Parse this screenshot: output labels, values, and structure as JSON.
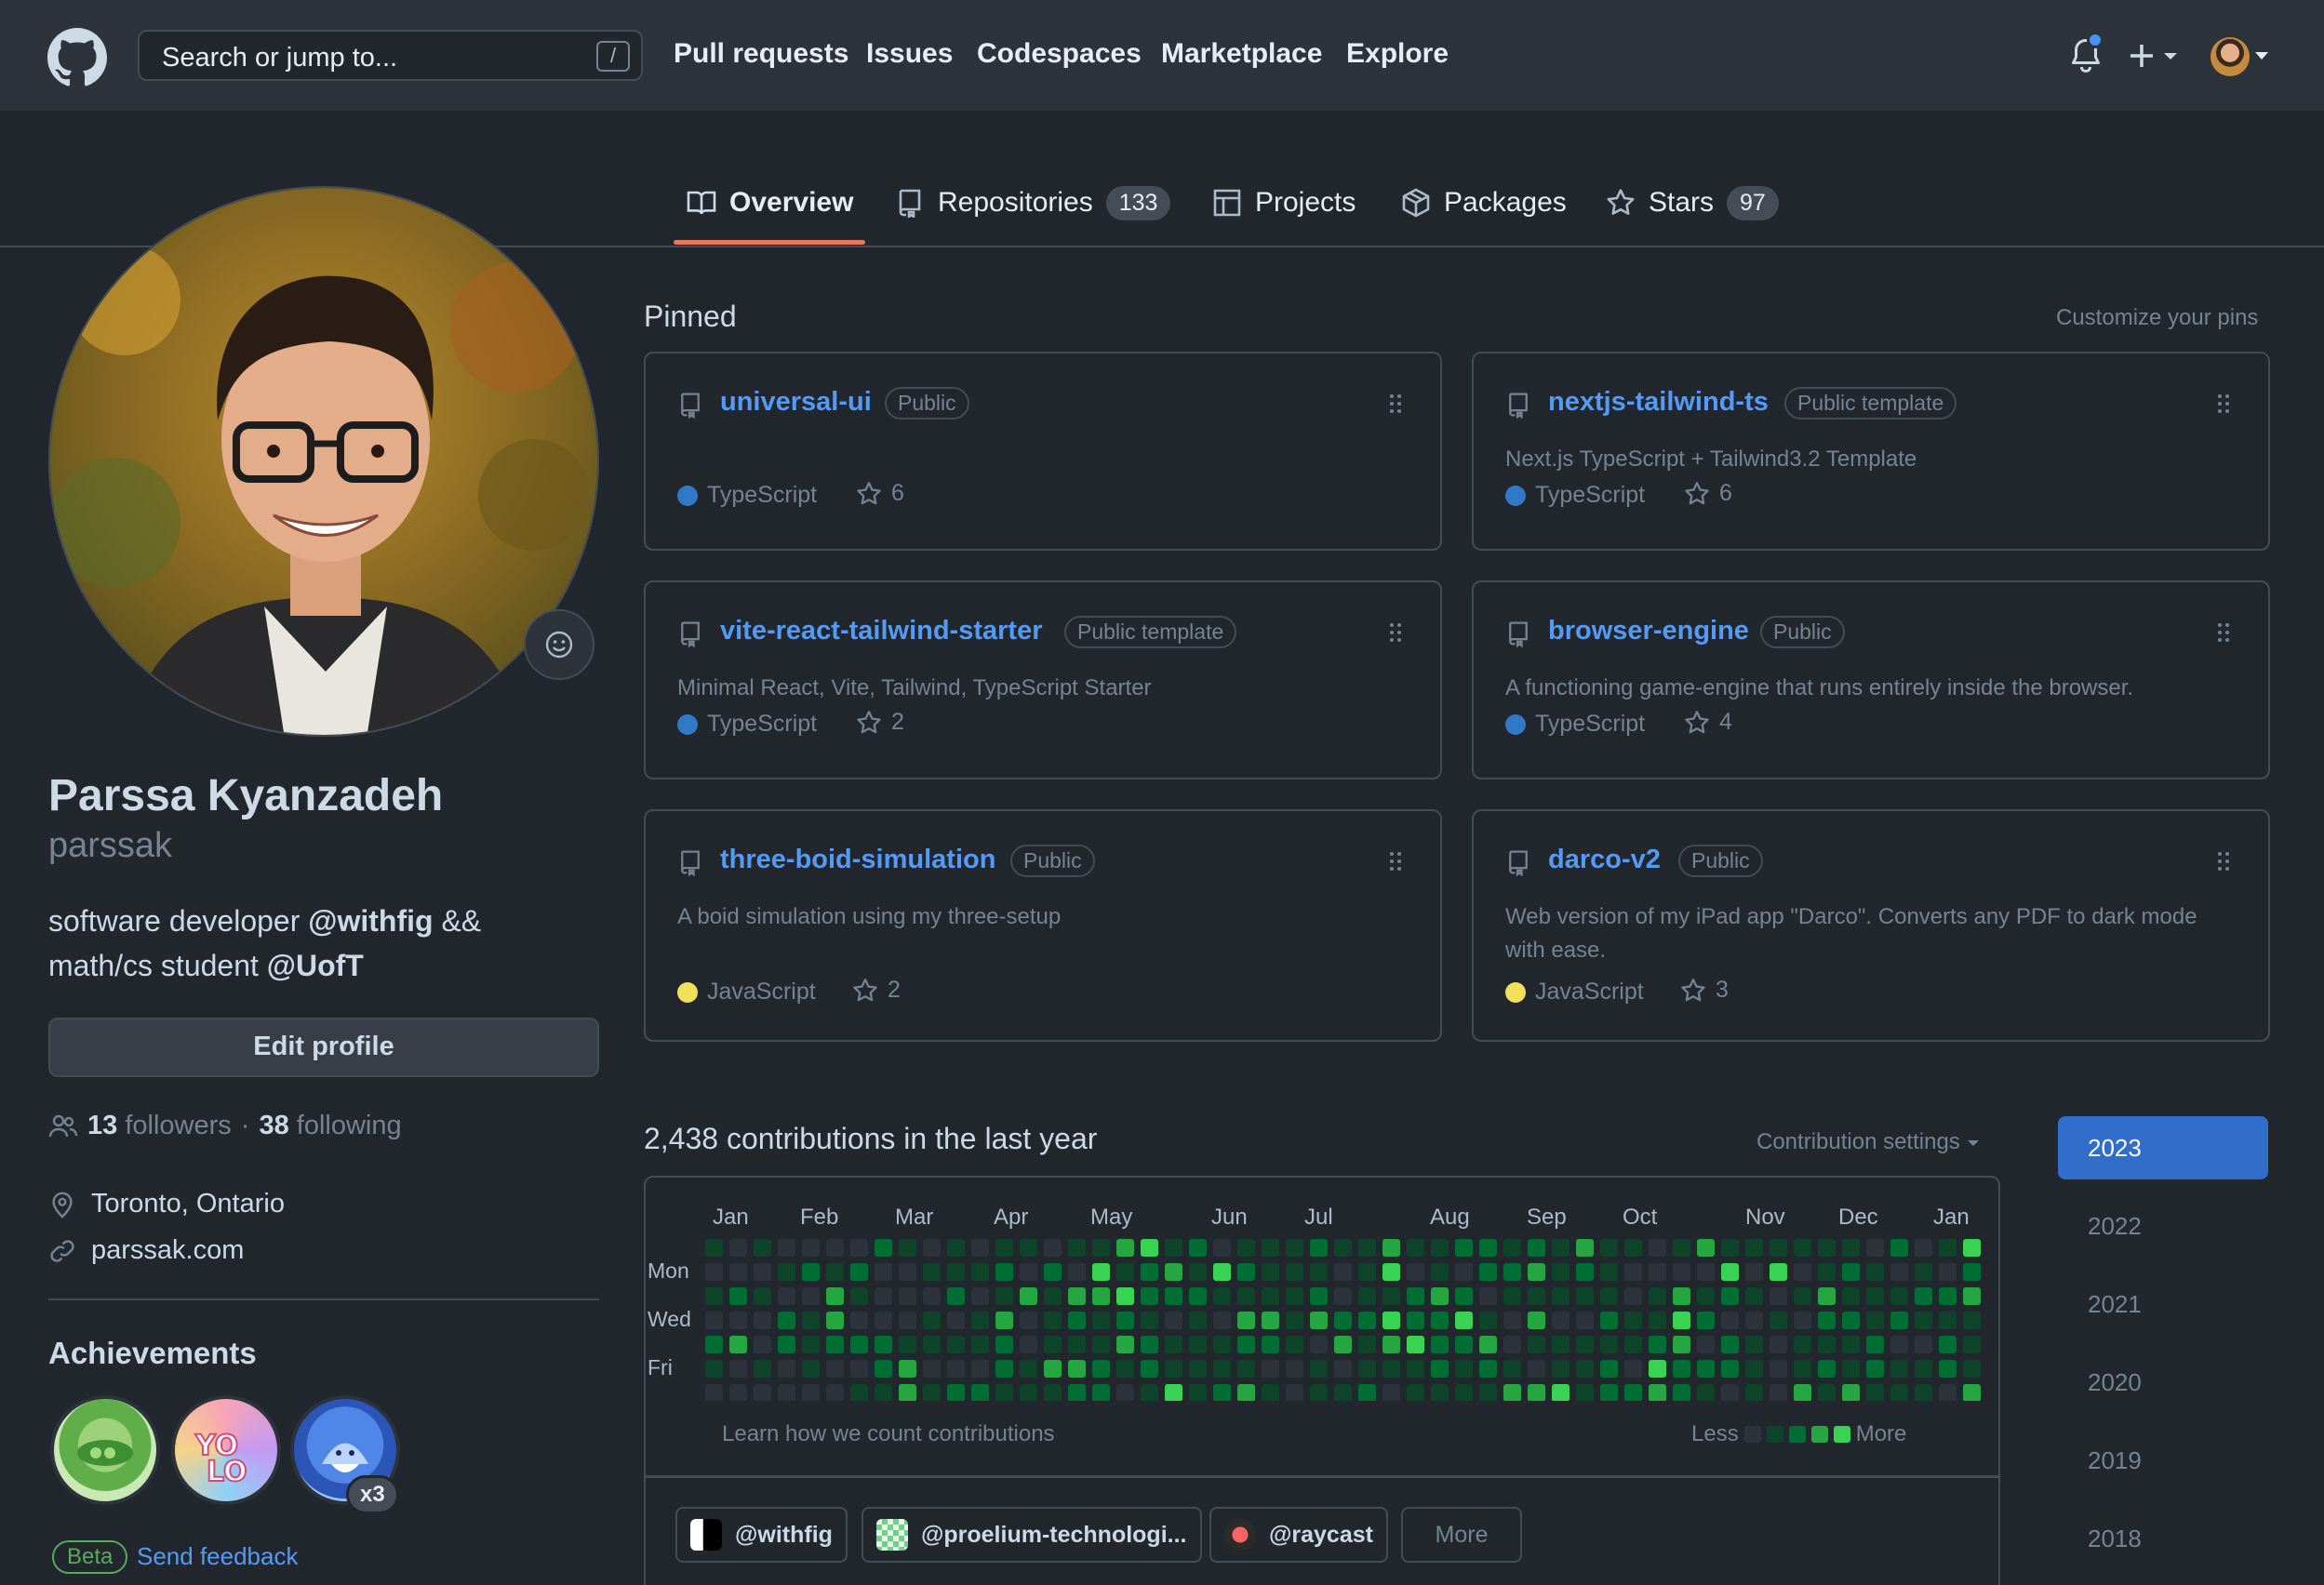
{
  "header": {
    "search_placeholder": "Search or jump to...",
    "search_shortcut": "/",
    "nav": [
      "Pull requests",
      "Issues",
      "Codespaces",
      "Marketplace",
      "Explore"
    ],
    "notification_dot_color": "#4493f8"
  },
  "tabs": [
    {
      "label": "Overview",
      "icon": "book-icon",
      "count": null,
      "active": true
    },
    {
      "label": "Repositories",
      "icon": "repo-icon",
      "count": "133"
    },
    {
      "label": "Projects",
      "icon": "table-icon",
      "count": null
    },
    {
      "label": "Packages",
      "icon": "package-icon",
      "count": null
    },
    {
      "label": "Stars",
      "icon": "star-icon",
      "count": "97"
    }
  ],
  "profile": {
    "name": "Parssa Kyanzadeh",
    "login": "parssak",
    "bio_line1_prefix": "software developer ",
    "bio_line1_org": "@withfig",
    "bio_line1_suffix": " &&",
    "bio_line2_prefix": "math/cs student ",
    "bio_line2_org": "@UofT",
    "edit_button": "Edit profile",
    "followers_count": "13",
    "followers_label": "followers",
    "separator": "·",
    "following_count": "38",
    "following_label": "following",
    "location": "Toronto, Ontario",
    "website": "parssak.com"
  },
  "achievements": {
    "title": "Achievements",
    "badges": [
      "peas-badge",
      "yolo-badge",
      "shark-badge"
    ],
    "shark_multiplier": "x3",
    "beta_label": "Beta",
    "feedback_label": "Send feedback"
  },
  "pinned": {
    "title": "Pinned",
    "customize": "Customize your pins",
    "repos": [
      {
        "name": "universal-ui",
        "visibility": "Public",
        "description": "",
        "language": "TypeScript",
        "lang_color": "#3178c6",
        "stars": "6"
      },
      {
        "name": "nextjs-tailwind-ts",
        "visibility": "Public template",
        "description": "Next.js TypeScript + Tailwind3.2 Template",
        "language": "TypeScript",
        "lang_color": "#3178c6",
        "stars": "6"
      },
      {
        "name": "vite-react-tailwind-starter",
        "visibility": "Public template",
        "description": "Minimal React, Vite, Tailwind, TypeScript Starter",
        "language": "TypeScript",
        "lang_color": "#3178c6",
        "stars": "2"
      },
      {
        "name": "browser-engine",
        "visibility": "Public",
        "description": "A functioning game-engine that runs entirely inside the browser.",
        "language": "TypeScript",
        "lang_color": "#3178c6",
        "stars": "4"
      },
      {
        "name": "three-boid-simulation",
        "visibility": "Public",
        "description": "A boid simulation using my three-setup",
        "language": "JavaScript",
        "lang_color": "#f1e05a",
        "stars": "2"
      },
      {
        "name": "darco-v2",
        "visibility": "Public",
        "description": "Web version of my iPad app \"Darco\". Converts any PDF to dark mode with ease.",
        "language": "JavaScript",
        "lang_color": "#f1e05a",
        "stars": "3"
      }
    ]
  },
  "contributions": {
    "title": "2,438 contributions in the last year",
    "settings": "Contribution settings",
    "months": [
      "Jan",
      "Feb",
      "Mar",
      "Apr",
      "May",
      "Jun",
      "Jul",
      "Aug",
      "Sep",
      "Oct",
      "Nov",
      "Dec",
      "Jan"
    ],
    "days": [
      "Mon",
      "Wed",
      "Fri"
    ],
    "learn": "Learn how we count contributions",
    "less": "Less",
    "more": "More",
    "level_colors": [
      "#2d333b",
      "#0e4429",
      "#006d32",
      "#26a641",
      "#39d353"
    ],
    "orgs": [
      "@withfig",
      "@proelium-technologi...",
      "@raycast"
    ],
    "more_button": "More"
  },
  "years": [
    "2023",
    "2022",
    "2021",
    "2020",
    "2019",
    "2018"
  ],
  "active_year": "2023"
}
